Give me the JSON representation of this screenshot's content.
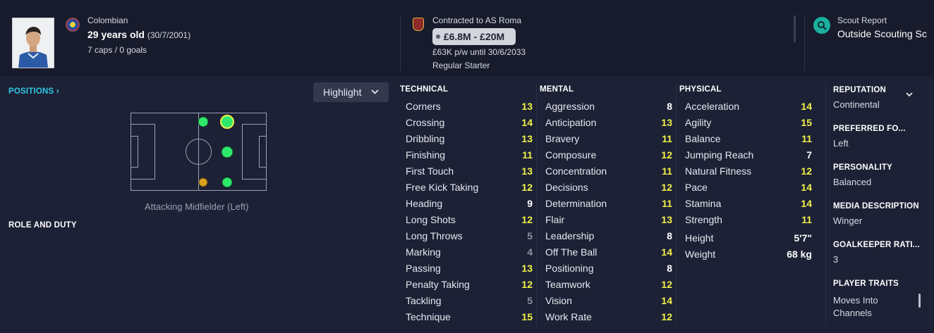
{
  "header": {
    "nationality": "Colombian",
    "age": "29 years old",
    "dob": "(30/7/2001)",
    "caps": "7 caps / 0 goals",
    "contract_club": "Contracted to AS Roma",
    "value_range": "£6.8M - £20M",
    "wage": "£63K p/w until 30/6/2033",
    "squad_status": "Regular Starter",
    "scout_title": "Scout Report",
    "scout_value": "Outside Scouting Sc"
  },
  "left": {
    "positions_label": "POSITIONS",
    "positions_chevron": "›",
    "role_caption": "Attacking Midfielder (Left)",
    "role_duty_label": "ROLE AND DUTY",
    "highlight_label": "Highlight",
    "highlight_chevron": "⌄"
  },
  "technical": {
    "title": "TECHNICAL",
    "items": [
      {
        "name": "Corners",
        "value": "13"
      },
      {
        "name": "Crossing",
        "value": "14"
      },
      {
        "name": "Dribbling",
        "value": "13"
      },
      {
        "name": "Finishing",
        "value": "11"
      },
      {
        "name": "First Touch",
        "value": "13"
      },
      {
        "name": "Free Kick Taking",
        "value": "12"
      },
      {
        "name": "Heading",
        "value": "9"
      },
      {
        "name": "Long Shots",
        "value": "12"
      },
      {
        "name": "Long Throws",
        "value": "5"
      },
      {
        "name": "Marking",
        "value": "4"
      },
      {
        "name": "Passing",
        "value": "13"
      },
      {
        "name": "Penalty Taking",
        "value": "12"
      },
      {
        "name": "Tackling",
        "value": "5"
      },
      {
        "name": "Technique",
        "value": "15"
      }
    ]
  },
  "mental": {
    "title": "MENTAL",
    "items": [
      {
        "name": "Aggression",
        "value": "8"
      },
      {
        "name": "Anticipation",
        "value": "13"
      },
      {
        "name": "Bravery",
        "value": "11"
      },
      {
        "name": "Composure",
        "value": "12"
      },
      {
        "name": "Concentration",
        "value": "11"
      },
      {
        "name": "Decisions",
        "value": "12"
      },
      {
        "name": "Determination",
        "value": "11"
      },
      {
        "name": "Flair",
        "value": "13"
      },
      {
        "name": "Leadership",
        "value": "8"
      },
      {
        "name": "Off The Ball",
        "value": "14"
      },
      {
        "name": "Positioning",
        "value": "8"
      },
      {
        "name": "Teamwork",
        "value": "12"
      },
      {
        "name": "Vision",
        "value": "14"
      },
      {
        "name": "Work Rate",
        "value": "12"
      }
    ]
  },
  "physical": {
    "title": "PHYSICAL",
    "items": [
      {
        "name": "Acceleration",
        "value": "14"
      },
      {
        "name": "Agility",
        "value": "15"
      },
      {
        "name": "Balance",
        "value": "11"
      },
      {
        "name": "Jumping Reach",
        "value": "7"
      },
      {
        "name": "Natural Fitness",
        "value": "12"
      },
      {
        "name": "Pace",
        "value": "14"
      },
      {
        "name": "Stamina",
        "value": "14"
      },
      {
        "name": "Strength",
        "value": "11"
      }
    ],
    "height_label": "Height",
    "height_value": "5'7\"",
    "weight_label": "Weight",
    "weight_value": "68 kg"
  },
  "right_panel": {
    "reputation_label": "REPUTATION",
    "reputation_value": "Continental",
    "preferred_foot_label": "PREFERRED FO...",
    "preferred_foot_value": "Left",
    "personality_label": "PERSONALITY",
    "personality_value": "Balanced",
    "media_label": "MEDIA DESCRIPTION",
    "media_value": "Winger",
    "gk_label": "GOALKEEPER RATI...",
    "gk_value": "3",
    "traits_label": "PLAYER TRAITS",
    "traits_line1": "Moves Into",
    "traits_line2": "Channels",
    "chevron": "⌄"
  },
  "colors": {
    "accent": "#2ec9e6",
    "high_value": "#f3f24a",
    "mid_value": "#ffffff",
    "low_value": "#8c90a0",
    "position_natural": "#2ee86b",
    "position_partial": "#d9a21b"
  }
}
